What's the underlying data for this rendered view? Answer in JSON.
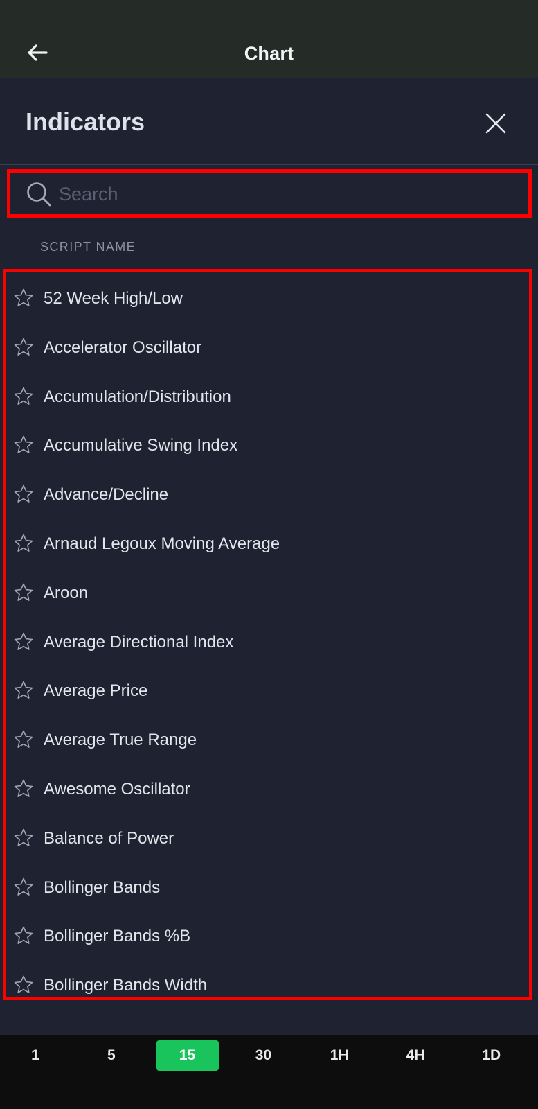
{
  "topbar": {
    "title": "Chart"
  },
  "panel": {
    "title": "Indicators",
    "search": {
      "placeholder": "Search",
      "value": ""
    },
    "section_label": "SCRIPT NAME",
    "items": [
      {
        "label": "52 Week High/Low"
      },
      {
        "label": "Accelerator Oscillator"
      },
      {
        "label": "Accumulation/Distribution"
      },
      {
        "label": "Accumulative Swing Index"
      },
      {
        "label": "Advance/Decline"
      },
      {
        "label": "Arnaud Legoux Moving Average"
      },
      {
        "label": "Aroon"
      },
      {
        "label": "Average Directional Index"
      },
      {
        "label": "Average Price"
      },
      {
        "label": "Average True Range"
      },
      {
        "label": "Awesome Oscillator"
      },
      {
        "label": "Balance of Power"
      },
      {
        "label": "Bollinger Bands"
      },
      {
        "label": "Bollinger Bands %B"
      },
      {
        "label": "Bollinger Bands Width"
      }
    ]
  },
  "timeframes": {
    "options": [
      {
        "label": "1"
      },
      {
        "label": "5"
      },
      {
        "label": "15"
      },
      {
        "label": "30"
      },
      {
        "label": "1H"
      },
      {
        "label": "4H"
      },
      {
        "label": "1D"
      }
    ],
    "selected": "15"
  },
  "colors": {
    "highlight_border": "#ff0000",
    "active_timeframe": "#19c45d",
    "panel_bg": "#1f2230",
    "topbar_bg": "#252b27"
  },
  "icons": {
    "back": "arrow-left-icon",
    "close": "close-icon",
    "search": "search-icon",
    "favorite": "star-outline-icon"
  }
}
